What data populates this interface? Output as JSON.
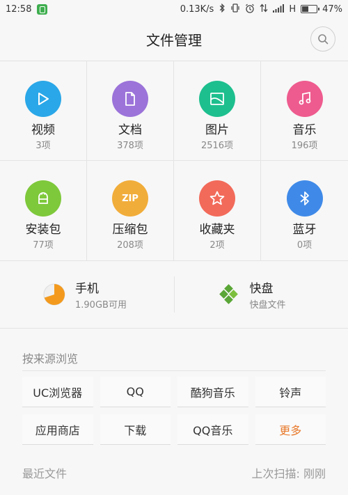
{
  "status": {
    "time": "12:58",
    "speed": "0.13K/s",
    "network": "H",
    "battery": "47%",
    "battery_level": 0.47
  },
  "header": {
    "title": "文件管理"
  },
  "categories": [
    {
      "label": "视频",
      "count": "3项",
      "color": "#2aa7e8",
      "icon": "play-icon"
    },
    {
      "label": "文档",
      "count": "378项",
      "color": "#9b73d9",
      "icon": "document-icon"
    },
    {
      "label": "图片",
      "count": "2516项",
      "color": "#1dbf8e",
      "icon": "image-icon"
    },
    {
      "label": "音乐",
      "count": "196项",
      "color": "#ee5b8e",
      "icon": "music-icon"
    },
    {
      "label": "安装包",
      "count": "77项",
      "color": "#7ec83b",
      "icon": "android-icon"
    },
    {
      "label": "压缩包",
      "count": "208项",
      "color": "#f1ad3a",
      "icon": "zip-icon",
      "icon_text": "ZIP"
    },
    {
      "label": "收藏夹",
      "count": "2项",
      "color": "#f26a5a",
      "icon": "star-icon"
    },
    {
      "label": "蓝牙",
      "count": "0项",
      "color": "#3f8ae8",
      "icon": "bluetooth-icon"
    }
  ],
  "storage": {
    "phone": {
      "name": "手机",
      "sub": "1.90GB可用",
      "used_fraction": 0.7
    },
    "kuaipan": {
      "name": "快盘",
      "sub": "快盘文件"
    }
  },
  "sources": {
    "title": "按来源浏览",
    "items": [
      "UC浏览器",
      "QQ",
      "酷狗音乐",
      "铃声",
      "应用商店",
      "下载",
      "QQ音乐",
      "更多"
    ]
  },
  "recent": {
    "title": "最近文件",
    "scan": "上次扫描: 刚刚"
  },
  "colors": {
    "accent_orange": "#e8792b"
  }
}
